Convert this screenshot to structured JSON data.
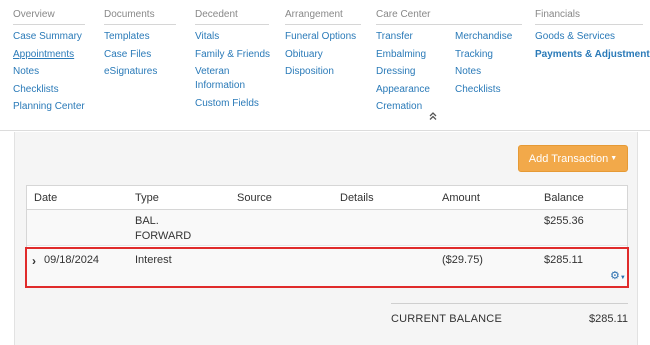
{
  "nav": {
    "overview": {
      "heading": "Overview",
      "items": [
        "Case Summary",
        "Appointments",
        "Notes",
        "Checklists",
        "Planning Center"
      ]
    },
    "documents": {
      "heading": "Documents",
      "items": [
        "Templates",
        "Case Files",
        "eSignatures"
      ]
    },
    "decedent": {
      "heading": "Decedent",
      "items": [
        "Vitals",
        "Family & Friends",
        "Veteran Information",
        "Custom Fields"
      ]
    },
    "arrangement": {
      "heading": "Arrangement",
      "items": [
        "Funeral Options",
        "Obituary",
        "Disposition"
      ]
    },
    "care_center": {
      "heading": "Care Center",
      "col1": [
        "Transfer",
        "Embalming",
        "Dressing",
        "Appearance",
        "Cremation"
      ],
      "col2": [
        "Merchandise",
        "Tracking",
        "Notes",
        "Checklists"
      ]
    },
    "financials": {
      "heading": "Financials",
      "items": [
        "Goods & Services",
        "Payments & Adjustments"
      ]
    },
    "collapse_icon": "double-chevron-up-icon"
  },
  "actions": {
    "add_transaction": "Add Transaction",
    "accent_color": "#f2a94a"
  },
  "table": {
    "columns": [
      "Date",
      "Type",
      "Source",
      "Details",
      "Amount",
      "Balance"
    ],
    "rows": [
      {
        "date": "",
        "type": "BAL. FORWARD",
        "source": "",
        "details": "",
        "amount": "",
        "balance": "$255.36"
      },
      {
        "date": "09/18/2024",
        "type": "Interest",
        "source": "",
        "details": "",
        "amount": "($29.75)",
        "balance": "$285.11"
      }
    ],
    "highlight_color": "#e02b2b"
  },
  "summary": {
    "label": "CURRENT BALANCE",
    "value": "$285.11"
  }
}
